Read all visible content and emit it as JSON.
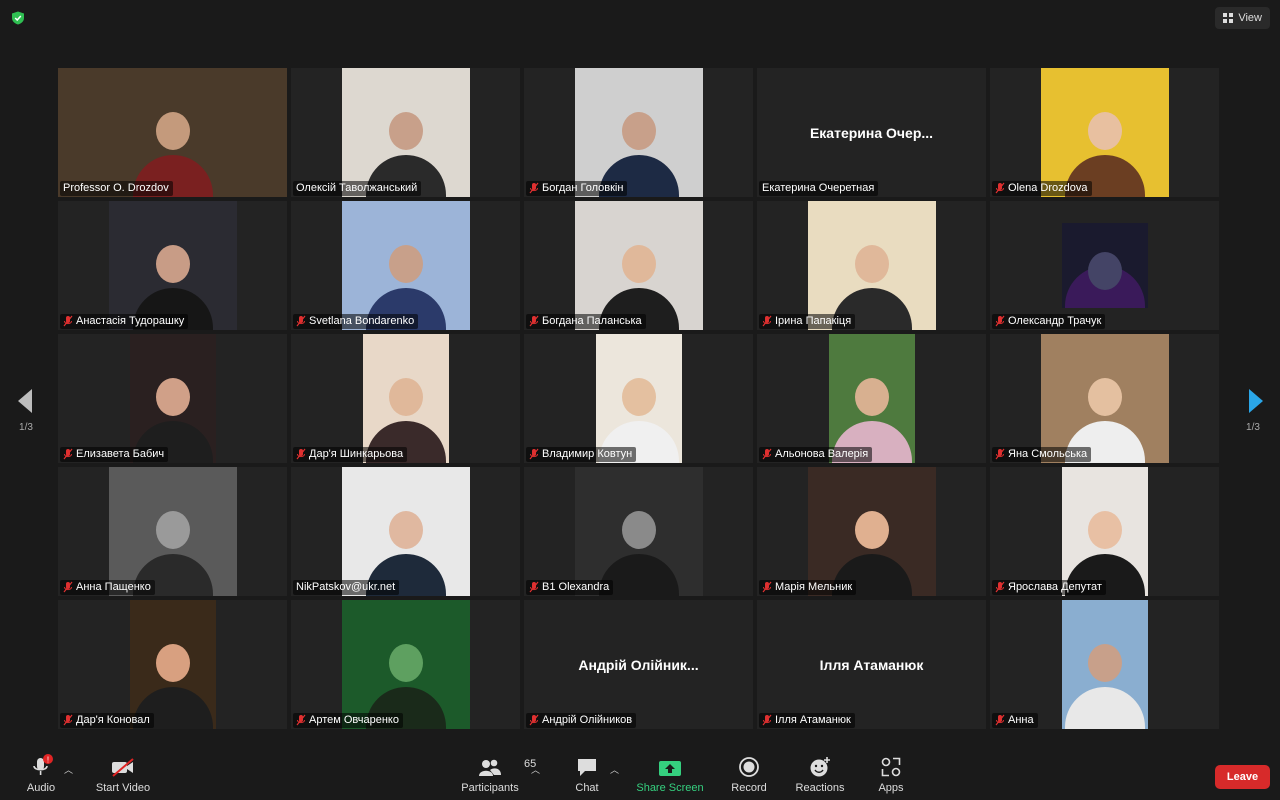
{
  "topbar": {
    "view_label": "View"
  },
  "pagination": {
    "left": "1/3",
    "right": "1/3"
  },
  "participants": [
    {
      "name": "Professor O. Drozdov",
      "muted": false,
      "active": true,
      "bg": "#4a3a2a",
      "skin": "#c49a7c",
      "shirt": "#7a2020",
      "video": "full"
    },
    {
      "name": "Олексій Таволжанський",
      "muted": false,
      "bg": "#ddd8d0",
      "skin": "#c8a08a",
      "shirt": "#2a2a2a",
      "video": "normal"
    },
    {
      "name": "Богдан Головкін",
      "muted": true,
      "bg": "#cfcfcf",
      "skin": "#c8a08a",
      "shirt": "#1d2a44",
      "video": "normal"
    },
    {
      "name": "Екатерина Очеретная",
      "muted": false,
      "big": "Екатерина Очер...",
      "video": "none"
    },
    {
      "name": "Olena Drozdova",
      "muted": true,
      "bg": "#e7c030",
      "skin": "#e8c0a0",
      "shirt": "#6b3e22",
      "video": "normal"
    },
    {
      "name": "Анастасія Тудорашку",
      "muted": true,
      "bg": "#2b2b32",
      "skin": "#c89c86",
      "shirt": "#161616",
      "video": "normal"
    },
    {
      "name": "Svetlana Bondarenko",
      "muted": true,
      "bg": "#9cb4d8",
      "skin": "#c8a08a",
      "shirt": "#2b3a6a",
      "video": "normal"
    },
    {
      "name": "Богдана Паланська",
      "muted": true,
      "bg": "#d8d4d0",
      "skin": "#e0b89a",
      "shirt": "#1e1e1e",
      "video": "normal"
    },
    {
      "name": "Ірина Папакіця",
      "muted": true,
      "bg": "#e9dcc0",
      "skin": "#e0b89a",
      "shirt": "#2a2a2a",
      "video": "normal"
    },
    {
      "name": "Олександр Трачук",
      "muted": true,
      "bg": "#1a1a2e",
      "skin": "#444466",
      "shirt": "#3a1a5a",
      "video": "small"
    },
    {
      "name": "Елизавета Бабич",
      "muted": true,
      "bg": "#2a2020",
      "skin": "#d0a088",
      "shirt": "#1e1e1e",
      "video": "mid"
    },
    {
      "name": "Дар'я Шинкарьова",
      "muted": true,
      "bg": "#e8d8c8",
      "skin": "#e0b89a",
      "shirt": "#3a2a2a",
      "video": "mid"
    },
    {
      "name": "Владимир Ковтун",
      "muted": true,
      "bg": "#ece6dc",
      "skin": "#e4c0a0",
      "shirt": "#f0f0f0",
      "video": "mid"
    },
    {
      "name": "Альонова Валерія",
      "muted": true,
      "bg": "#4e7a3e",
      "skin": "#d8b090",
      "shirt": "#d8b0c0",
      "video": "mid"
    },
    {
      "name": "Яна Смольська",
      "muted": true,
      "bg": "#a08060",
      "skin": "#e4c0a0",
      "shirt": "#eeeeee",
      "video": "normal"
    },
    {
      "name": "Анна Пащенко",
      "muted": true,
      "bg": "#5a5a5a",
      "skin": "#9a9a9a",
      "shirt": "#2a2a2a",
      "video": "normal"
    },
    {
      "name": "NikPatskov@ukr.net",
      "muted": false,
      "bg": "#e8e8e8",
      "skin": "#e0b8a0",
      "shirt": "#1e2a3a",
      "video": "normal"
    },
    {
      "name": "B1 Olexandra",
      "muted": true,
      "bg": "#2e2e2e",
      "skin": "#8a8a8a",
      "shirt": "#1a1a1a",
      "video": "normal"
    },
    {
      "name": "Марія Мельник",
      "muted": true,
      "bg": "#3a2a24",
      "skin": "#e0b090",
      "shirt": "#1a1a1a",
      "video": "normal"
    },
    {
      "name": "Ярослава Депутат",
      "muted": true,
      "bg": "#e8e4e0",
      "skin": "#e8c0a4",
      "shirt": "#1a1a1a",
      "video": "mid"
    },
    {
      "name": "Дар'я Коновал",
      "muted": true,
      "bg": "#3a2a1a",
      "skin": "#d8a080",
      "shirt": "#1e1e1e",
      "video": "mid"
    },
    {
      "name": "Артем Овчаренко",
      "muted": true,
      "bg": "#1c5a2a",
      "skin": "#5ea060",
      "shirt": "#1a2a1a",
      "video": "normal"
    },
    {
      "name": "Андрій Олійников",
      "muted": true,
      "big": "Андрій Олійник...",
      "video": "none"
    },
    {
      "name": "Ілля Атаманюк",
      "muted": true,
      "big": "Ілля Атаманюк",
      "video": "none"
    },
    {
      "name": "Анна",
      "muted": true,
      "bg": "#8aaed0",
      "skin": "#c8a08a",
      "shirt": "#e8e8e8",
      "video": "mid"
    }
  ],
  "toolbar": {
    "audio": "Audio",
    "audio_badge": "!",
    "start_video": "Start Video",
    "participants": "Participants",
    "participants_count": "65",
    "chat": "Chat",
    "share_screen": "Share Screen",
    "record": "Record",
    "reactions": "Reactions",
    "apps": "Apps",
    "leave": "Leave"
  },
  "colors": {
    "accent_green": "#35d07f",
    "active_speaker": "#c9e26a",
    "leave_red": "#d72a2a",
    "arrow_blue": "#2aa6e8"
  }
}
